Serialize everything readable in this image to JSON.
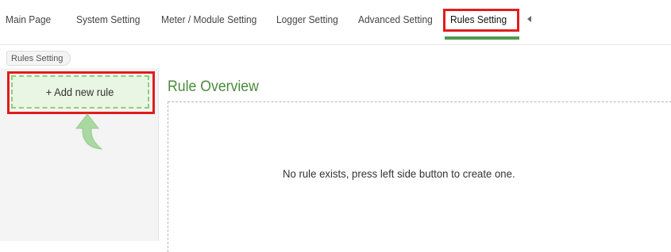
{
  "nav": {
    "items": [
      "Main Page",
      "System Setting",
      "Meter / Module Setting",
      "Logger Setting",
      "Advanced Setting",
      "Rules Setting"
    ],
    "active": "Rules Setting",
    "accent_color": "#4f9a4f",
    "highlight_color": "#e11c1c"
  },
  "breadcrumb": {
    "label": "Rules Setting"
  },
  "sidebar": {
    "add_button_label": "+ Add new rule",
    "hint_icon": "curved-arrow-up-icon"
  },
  "main": {
    "title": "Rule Overview",
    "title_color": "#4b8a3c",
    "empty_message": "No rule exists, press left side button to create one."
  }
}
